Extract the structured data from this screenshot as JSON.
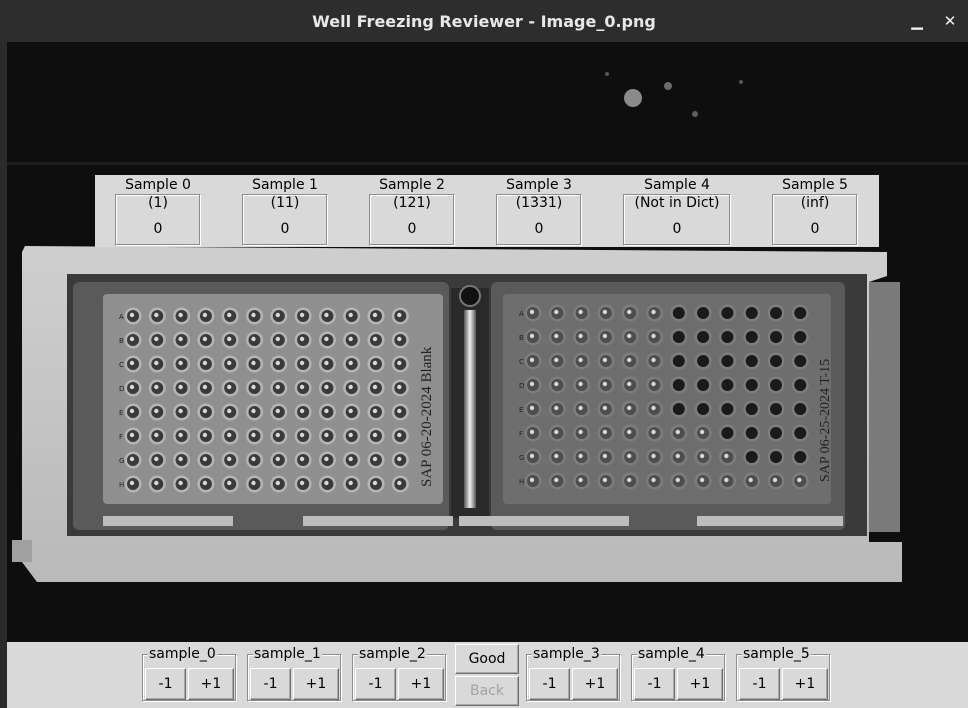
{
  "window": {
    "title": "Well Freezing Reviewer - Image_0.png",
    "minimize_symbol": "▁",
    "close_symbol": "✕"
  },
  "samples": [
    {
      "title": "Sample 0",
      "subtitle": "(1)",
      "count": "0"
    },
    {
      "title": "Sample 1",
      "subtitle": "(11)",
      "count": "0"
    },
    {
      "title": "Sample 2",
      "subtitle": "(121)",
      "count": "0"
    },
    {
      "title": "Sample 3",
      "subtitle": "(1331)",
      "count": "0"
    },
    {
      "title": "Sample 4",
      "subtitle": "(Not in Dict)",
      "count": "0"
    },
    {
      "title": "Sample 5",
      "subtitle": "(inf)",
      "count": "0"
    }
  ],
  "controls": {
    "groups": [
      {
        "label": "sample_0",
        "minus": "-1",
        "plus": "+1"
      },
      {
        "label": "sample_1",
        "minus": "-1",
        "plus": "+1"
      },
      {
        "label": "sample_2",
        "minus": "-1",
        "plus": "+1"
      },
      {
        "label": "sample_3",
        "minus": "-1",
        "plus": "+1"
      },
      {
        "label": "sample_4",
        "minus": "-1",
        "plus": "+1"
      },
      {
        "label": "sample_5",
        "minus": "-1",
        "plus": "+1"
      }
    ],
    "good_label": "Good",
    "back_label": "Back"
  },
  "plate_image": {
    "left_plate_handwriting": "SAP 06-20-2024 Blank",
    "right_plate_handwriting": "SAP 06-25-2024 T-15",
    "row_letters": [
      "A",
      "B",
      "C",
      "D",
      "E",
      "F",
      "G",
      "H"
    ],
    "right_plate_frozen_wells": {
      "A": 6,
      "B": 6,
      "C": 6,
      "D": 6,
      "E": 6,
      "F": 4,
      "G": 3,
      "H": 0
    }
  },
  "colors": {
    "titlebar_bg": "#2d2d2d",
    "panel_bg": "#d9d9d9",
    "disabled_text": "#a3a3a3"
  }
}
